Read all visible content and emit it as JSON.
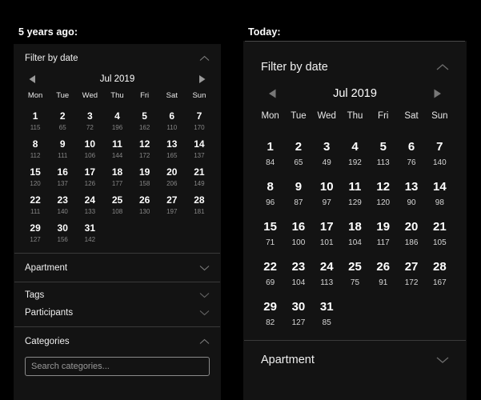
{
  "page": {
    "background": "#000000",
    "panel_background": "#131313",
    "divider_color": "#3a3a3a"
  },
  "left_column": {
    "heading": "5 years ago:",
    "filter_panel": {
      "title": "Filter by date",
      "collapse_icon": "chevron-up-icon",
      "calendar": {
        "prev_icon": "triangle-left-icon",
        "next_icon": "triangle-right-icon",
        "month_label": "Jul 2019",
        "weekdays": [
          "Mon",
          "Tue",
          "Wed",
          "Thu",
          "Fri",
          "Sat",
          "Sun"
        ],
        "weeks": [
          [
            {
              "day": "1",
              "value": "115"
            },
            {
              "day": "2",
              "value": "65"
            },
            {
              "day": "3",
              "value": "72"
            },
            {
              "day": "4",
              "value": "196"
            },
            {
              "day": "5",
              "value": "162"
            },
            {
              "day": "6",
              "value": "110"
            },
            {
              "day": "7",
              "value": "170"
            }
          ],
          [
            {
              "day": "8",
              "value": "112"
            },
            {
              "day": "9",
              "value": "111"
            },
            {
              "day": "10",
              "value": "106"
            },
            {
              "day": "11",
              "value": "144"
            },
            {
              "day": "12",
              "value": "172"
            },
            {
              "day": "13",
              "value": "165"
            },
            {
              "day": "14",
              "value": "137"
            }
          ],
          [
            {
              "day": "15",
              "value": "120"
            },
            {
              "day": "16",
              "value": "137"
            },
            {
              "day": "17",
              "value": "126"
            },
            {
              "day": "18",
              "value": "177"
            },
            {
              "day": "19",
              "value": "158"
            },
            {
              "day": "20",
              "value": "206"
            },
            {
              "day": "21",
              "value": "149"
            }
          ],
          [
            {
              "day": "22",
              "value": "111"
            },
            {
              "day": "23",
              "value": "140"
            },
            {
              "day": "24",
              "value": "133"
            },
            {
              "day": "25",
              "value": "108"
            },
            {
              "day": "26",
              "value": "130"
            },
            {
              "day": "27",
              "value": "197"
            },
            {
              "day": "28",
              "value": "181"
            }
          ],
          [
            {
              "day": "29",
              "value": "127"
            },
            {
              "day": "30",
              "value": "156"
            },
            {
              "day": "31",
              "value": "142"
            },
            {
              "day": "",
              "value": ""
            },
            {
              "day": "",
              "value": ""
            },
            {
              "day": "",
              "value": ""
            },
            {
              "day": "",
              "value": ""
            }
          ]
        ]
      }
    },
    "apartment_section": {
      "label": "Apartment",
      "expand_icon": "chevron-down-icon"
    },
    "tags_section": {
      "tags_label": "Tags",
      "tags_icon": "chevron-down-icon",
      "participants_label": "Participants",
      "participants_icon": "chevron-down-icon"
    },
    "categories_section": {
      "label": "Categories",
      "collapse_icon": "chevron-up-icon",
      "search_placeholder": "Search categories...",
      "search_value": ""
    }
  },
  "right_column": {
    "heading": "Today:",
    "filter_panel": {
      "title": "Filter by date",
      "collapse_icon": "chevron-up-icon",
      "calendar": {
        "prev_icon": "triangle-left-icon",
        "next_icon": "triangle-right-icon",
        "month_label": "Jul 2019",
        "weekdays": [
          "Mon",
          "Tue",
          "Wed",
          "Thu",
          "Fri",
          "Sat",
          "Sun"
        ],
        "weeks": [
          [
            {
              "day": "1",
              "value": "84"
            },
            {
              "day": "2",
              "value": "65"
            },
            {
              "day": "3",
              "value": "49"
            },
            {
              "day": "4",
              "value": "192"
            },
            {
              "day": "5",
              "value": "113"
            },
            {
              "day": "6",
              "value": "76"
            },
            {
              "day": "7",
              "value": "140"
            }
          ],
          [
            {
              "day": "8",
              "value": "96"
            },
            {
              "day": "9",
              "value": "87"
            },
            {
              "day": "10",
              "value": "97"
            },
            {
              "day": "11",
              "value": "129"
            },
            {
              "day": "12",
              "value": "120"
            },
            {
              "day": "13",
              "value": "90"
            },
            {
              "day": "14",
              "value": "98"
            }
          ],
          [
            {
              "day": "15",
              "value": "71"
            },
            {
              "day": "16",
              "value": "100"
            },
            {
              "day": "17",
              "value": "101"
            },
            {
              "day": "18",
              "value": "104"
            },
            {
              "day": "19",
              "value": "117"
            },
            {
              "day": "20",
              "value": "186"
            },
            {
              "day": "21",
              "value": "105"
            }
          ],
          [
            {
              "day": "22",
              "value": "69"
            },
            {
              "day": "23",
              "value": "104"
            },
            {
              "day": "24",
              "value": "113"
            },
            {
              "day": "25",
              "value": "75"
            },
            {
              "day": "26",
              "value": "91"
            },
            {
              "day": "27",
              "value": "172"
            },
            {
              "day": "28",
              "value": "167"
            }
          ],
          [
            {
              "day": "29",
              "value": "82"
            },
            {
              "day": "30",
              "value": "127"
            },
            {
              "day": "31",
              "value": "85"
            },
            {
              "day": "",
              "value": ""
            },
            {
              "day": "",
              "value": ""
            },
            {
              "day": "",
              "value": ""
            },
            {
              "day": "",
              "value": ""
            }
          ]
        ]
      }
    },
    "apartment_section": {
      "label": "Apartment",
      "expand_icon": "chevron-down-icon"
    }
  }
}
